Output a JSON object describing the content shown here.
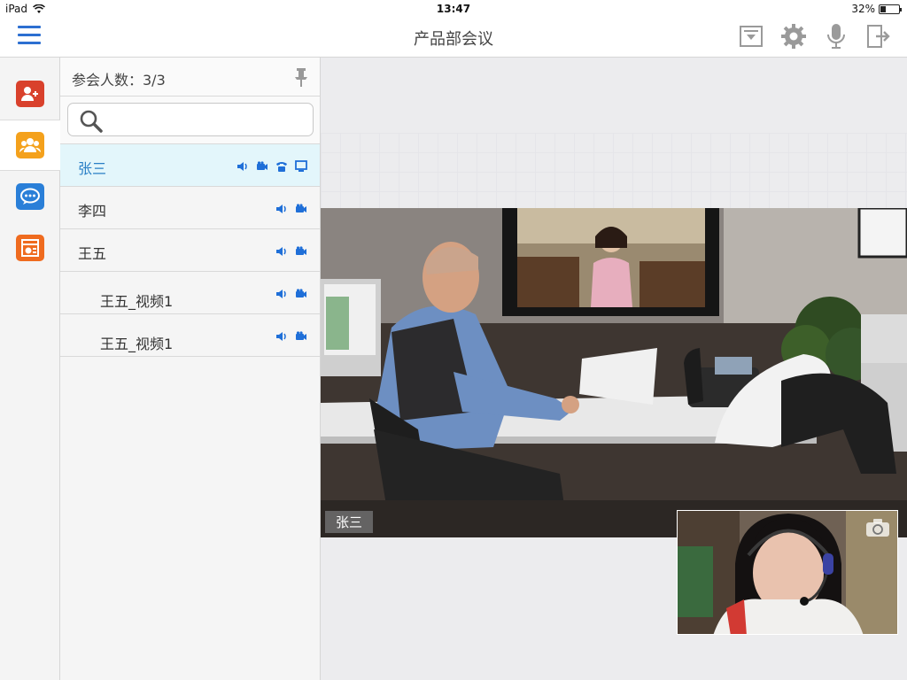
{
  "status_bar": {
    "device": "iPad",
    "time": "13:47",
    "battery": "32%",
    "battery_level": 0.32
  },
  "nav": {
    "title": "产品部会议",
    "actions": [
      "layout-dropdown-icon",
      "settings-gear-icon",
      "microphone-icon",
      "exit-meeting-icon"
    ]
  },
  "rail": {
    "items": [
      {
        "name": "invite",
        "icon": "add-user-icon",
        "color": "#d9412c"
      },
      {
        "name": "participants",
        "icon": "group-icon",
        "color": "#f4a11c"
      },
      {
        "name": "chat",
        "icon": "chat-bubble-icon",
        "color": "#2a7fd8"
      },
      {
        "name": "share",
        "icon": "presentation-icon",
        "color": "#ef6b1f"
      }
    ]
  },
  "panel": {
    "count_label": "参会人数：3/3",
    "search_placeholder": "",
    "participants": [
      {
        "name": "张三",
        "selected": true,
        "sub": false,
        "icons": [
          "speaker",
          "camera",
          "phone",
          "screen"
        ]
      },
      {
        "name": "李四",
        "selected": false,
        "sub": false,
        "icons": [
          "speaker",
          "camera"
        ]
      },
      {
        "name": "王五",
        "selected": false,
        "sub": false,
        "icons": [
          "speaker",
          "camera"
        ]
      },
      {
        "name": "王五_视频1",
        "selected": false,
        "sub": true,
        "icons": [
          "speaker",
          "camera"
        ]
      },
      {
        "name": "王五_视频1",
        "selected": false,
        "sub": true,
        "icons": [
          "speaker",
          "camera"
        ]
      }
    ]
  },
  "video": {
    "main_speaker": "张三",
    "accent": "#2a7fc6"
  }
}
